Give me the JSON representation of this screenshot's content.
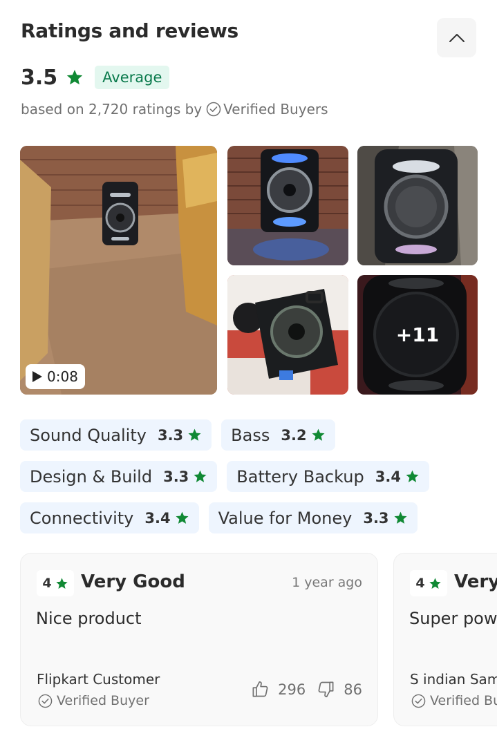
{
  "section": {
    "title": "Ratings and reviews"
  },
  "summary": {
    "rating": "3.5",
    "label": "Average",
    "based_on": "based on 2,720 ratings by",
    "verified": "Verified Buyers",
    "star_color": "#108934"
  },
  "gallery": {
    "video_duration": "0:08",
    "more_count": "+11"
  },
  "attributes": [
    {
      "label": "Sound Quality",
      "value": "3.3"
    },
    {
      "label": "Bass",
      "value": "3.2"
    },
    {
      "label": "Design & Build",
      "value": "3.3"
    },
    {
      "label": "Battery Backup",
      "value": "3.4"
    },
    {
      "label": "Connectivity",
      "value": "3.4"
    },
    {
      "label": "Value for Money",
      "value": "3.3"
    }
  ],
  "reviews": [
    {
      "score": "4",
      "title": "Very Good",
      "time": "1 year ago",
      "text": "Nice product",
      "author": "Flipkart Customer",
      "verified": "Verified Buyer",
      "likes": "296",
      "dislikes": "86"
    },
    {
      "score": "4",
      "title": "Very",
      "text": "Super pow",
      "author": "S indian Sam",
      "verified": "Verified Bu"
    }
  ]
}
